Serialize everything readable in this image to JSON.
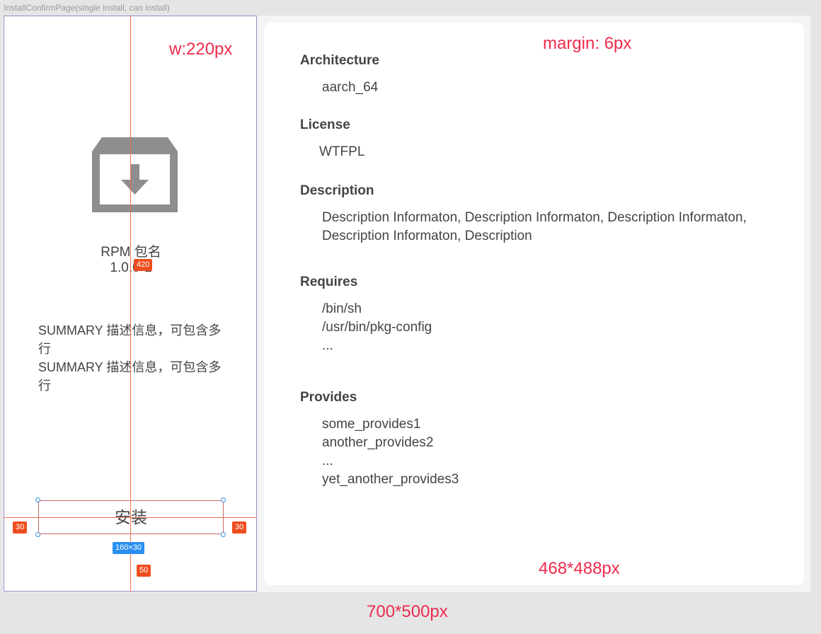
{
  "frame_title": "InstallConfirmPage(single install, can install)",
  "left": {
    "package_name": "RPM 包名",
    "package_version": "1.0.0-1",
    "summary_lines": [
      "SUMMARY 描述信息，可包含多行",
      "SUMMARY 描述信息，可包含多行"
    ],
    "install_label": "安装",
    "icon": "package-download-icon"
  },
  "right": {
    "architecture": {
      "label": "Architecture",
      "value": "aarch_64"
    },
    "license": {
      "label": "License",
      "value": "WTFPL"
    },
    "description": {
      "label": "Description",
      "lines": [
        "Description Informaton, Description Informaton, Description Informaton,",
        "Description Informaton, Description"
      ]
    },
    "requires": {
      "label": "Requires",
      "items": [
        "/bin/sh",
        "/usr/bin/pkg-config",
        "..."
      ]
    },
    "provides": {
      "label": "Provides",
      "items": [
        "some_provides1",
        "another_provides2",
        "...",
        "yet_another_provides3"
      ]
    }
  },
  "annotations": {
    "left_width": "w:220px",
    "margin": "margin: 6px",
    "right_size": "468*488px",
    "window_size": "700*500px",
    "badge_420": "420",
    "badge_30_left": "30",
    "badge_30_right": "30",
    "badge_size": "160×30",
    "badge_50": "50"
  },
  "colors": {
    "annotation": "#ee2b4d",
    "guide": "#f07050",
    "badge_red": "#ee4e1e",
    "badge_blue": "#2b8ff0",
    "icon": "#8e8e8e"
  }
}
